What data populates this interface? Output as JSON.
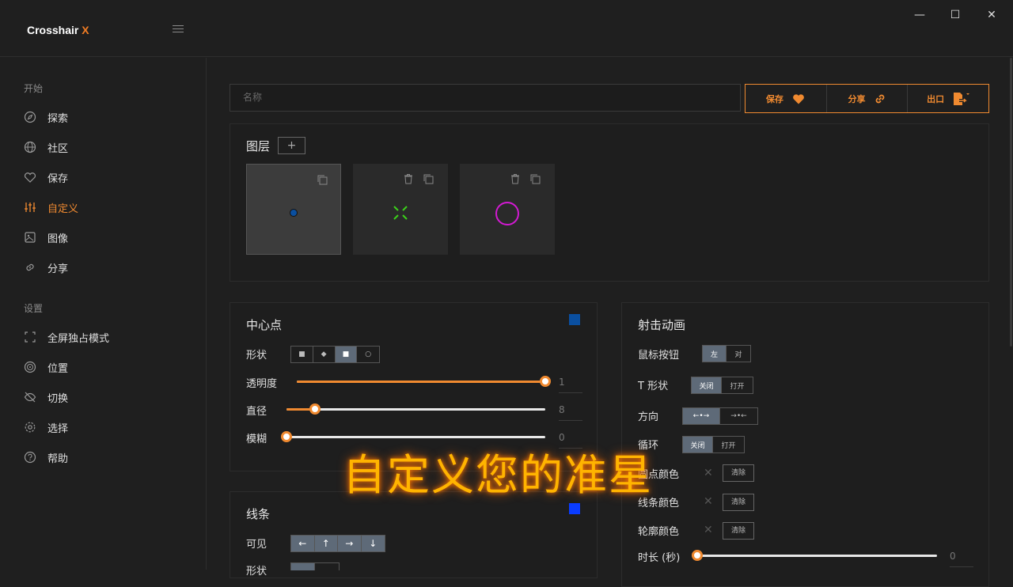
{
  "app": {
    "title_prefix": "Crosshair ",
    "title_accent": "X"
  },
  "window_controls": {
    "minimize": "—",
    "maximize": "☐",
    "close": "✕"
  },
  "sidebar": {
    "section_start": "开始",
    "items_start": [
      {
        "label": "探索",
        "icon": "compass-icon"
      },
      {
        "label": "社区",
        "icon": "globe-icon"
      },
      {
        "label": "保存",
        "icon": "heart-icon"
      },
      {
        "label": "自定义",
        "icon": "sliders-icon",
        "active": true
      },
      {
        "label": "图像",
        "icon": "image-icon"
      },
      {
        "label": "分享",
        "icon": "link-icon"
      }
    ],
    "section_settings": "设置",
    "items_settings": [
      {
        "label": "全屏独占模式",
        "icon": "fullscreen-icon"
      },
      {
        "label": "位置",
        "icon": "target-icon"
      },
      {
        "label": "切换",
        "icon": "eye-off-icon"
      },
      {
        "label": "选择",
        "icon": "gear-icon"
      },
      {
        "label": "帮助",
        "icon": "help-icon"
      }
    ]
  },
  "name_input": {
    "placeholder": "名称"
  },
  "actions": {
    "save": "保存",
    "share": "分享",
    "export": "出口"
  },
  "layers": {
    "title": "图层",
    "add": "+"
  },
  "center_dot": {
    "title": "中心点",
    "color": "#0a4fa0",
    "shape_label": "形状",
    "opacity_label": "透明度",
    "opacity_value": "1",
    "opacity_fraction": 1.0,
    "diameter_label": "直径",
    "diameter_value": "8",
    "diameter_fraction": 0.11,
    "blur_label": "模糊",
    "blur_value": "0",
    "blur_fraction": 0.0
  },
  "lines": {
    "title": "线条",
    "color": "#0a3cff",
    "visible_label": "可见",
    "shape_label": "形状",
    "directions": [
      "←",
      "↑",
      "→",
      "↓"
    ]
  },
  "shoot_anim": {
    "title": "射击动画",
    "mouse_button_label": "鼠标按钮",
    "mouse_left": "左",
    "mouse_right": "对",
    "t_shape_label": "T 形状",
    "off": "关闭",
    "on": "打开",
    "direction_label": "方向",
    "dir_in": "←•→",
    "dir_out": "→•←",
    "loop_label": "循环",
    "dot_color_label": "圆点颜色",
    "clear": "清除",
    "line_color_label": "线条颜色",
    "outline_color_label": "轮廓颜色",
    "duration_label": "时长 (秒)",
    "duration_value": "0",
    "duration_fraction": 0.0
  },
  "caption": "自定义您的准星"
}
